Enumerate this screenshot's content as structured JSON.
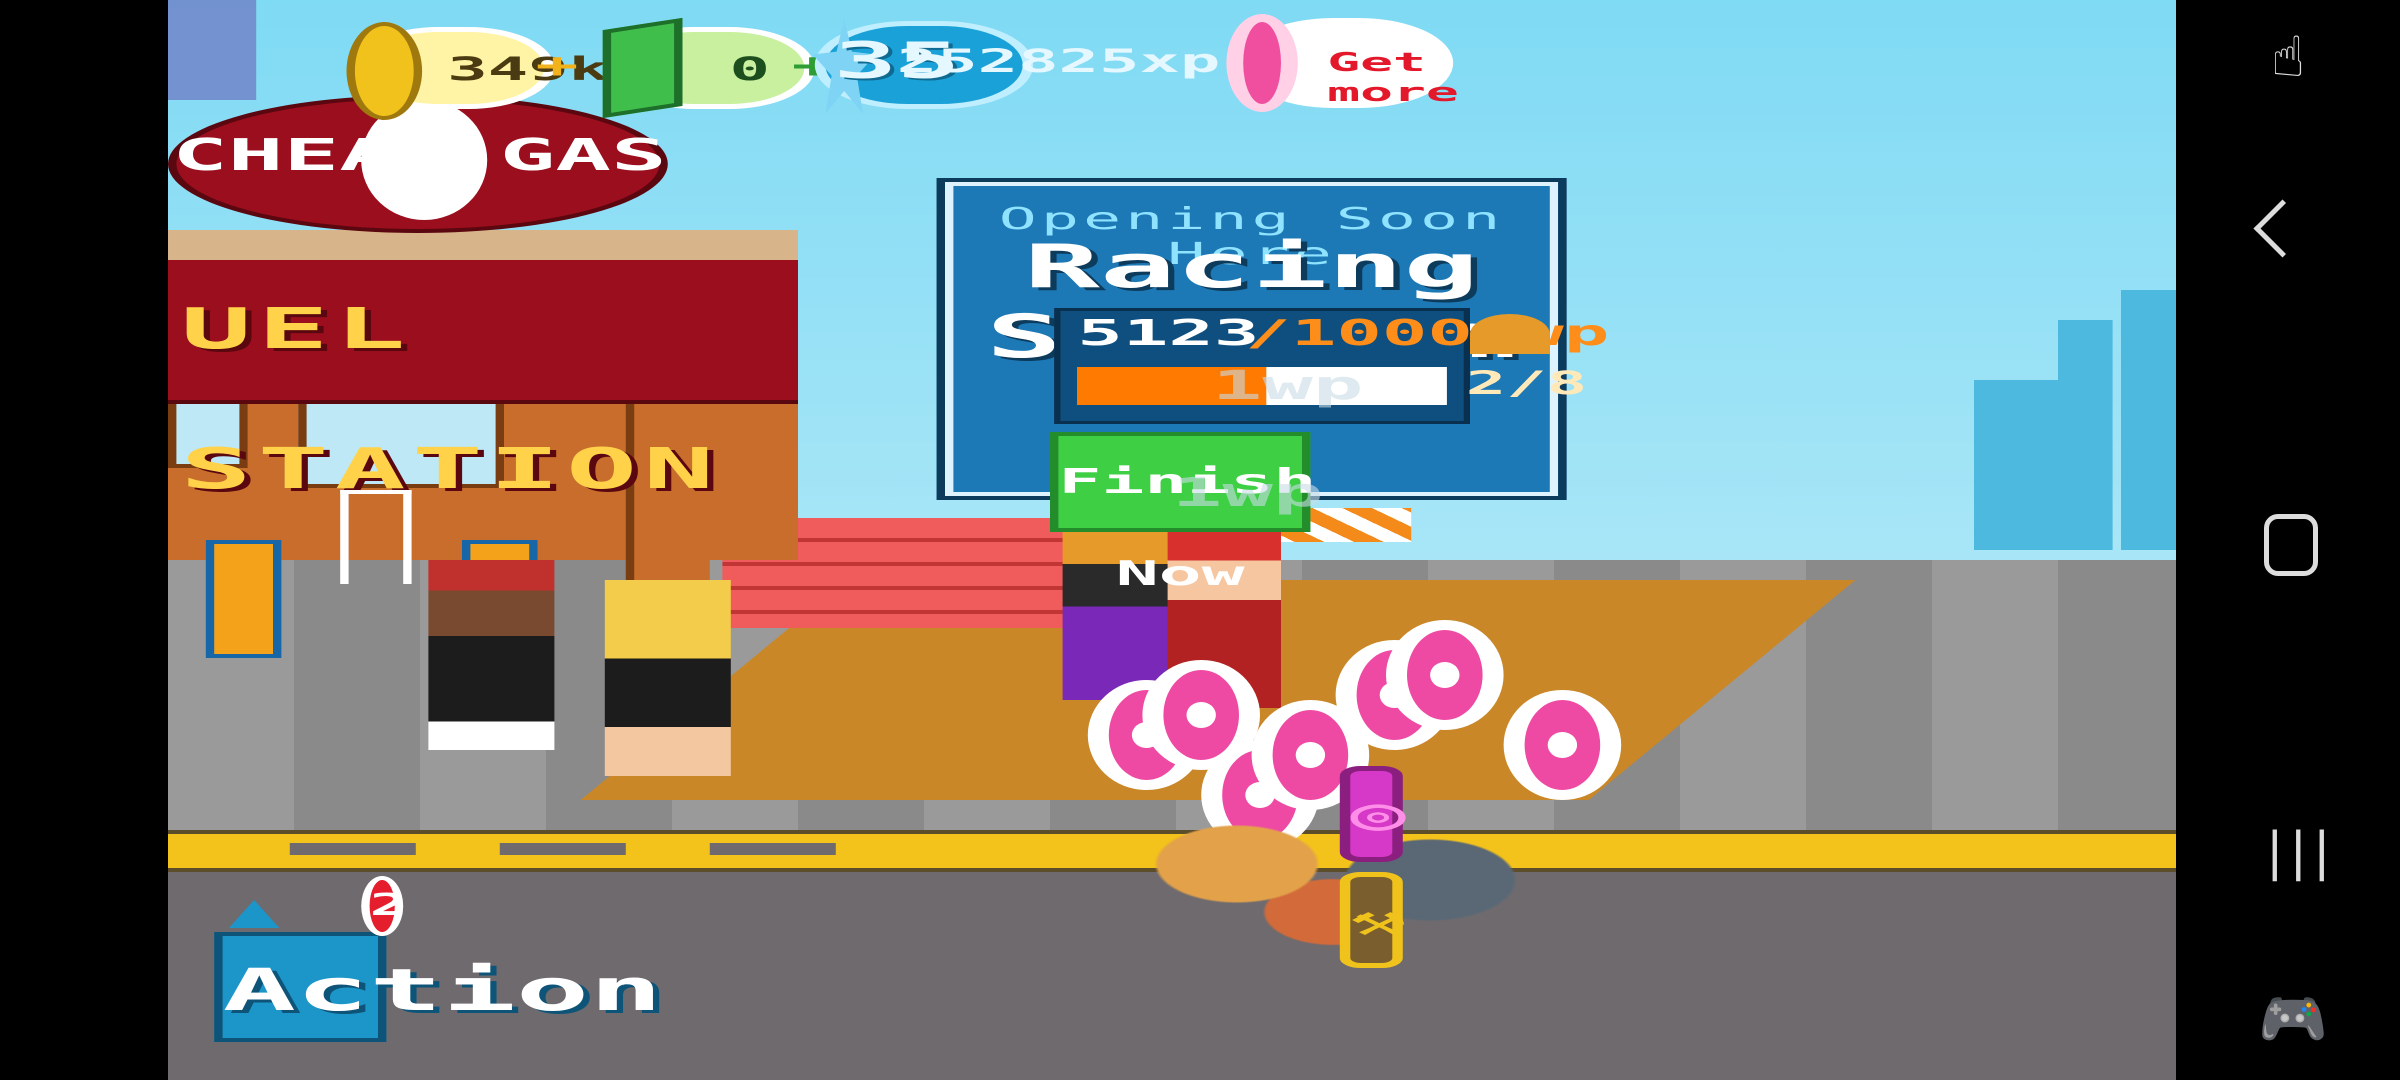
{
  "hud": {
    "coins": "349k",
    "cash": "0",
    "plus_symbol": "+",
    "level": "35",
    "xp": "252825xp",
    "get_more": "Get more"
  },
  "station": {
    "sign_left": "CHEAP",
    "sign_right": "GAS",
    "banner": "UEL STATION"
  },
  "construction": {
    "subtitle": "Opening Soon Here",
    "title": "Racing Stadium",
    "progress": "5123",
    "goal": "/10000wp",
    "progress_fraction": 0.5123,
    "helmet_count": "2/8",
    "finish_label": "Finish Now",
    "float_label_1": "1wp",
    "float_label_2": "1wp"
  },
  "action": {
    "label": "Action",
    "badge": "2"
  },
  "colors": {
    "sky": "#7fdaf4",
    "station_red": "#9b0e1e",
    "sign_yellow": "#ffd24a",
    "board_blue": "#1d78b6",
    "progress_orange": "#ff7a00",
    "finish_green": "#3fcf45",
    "donut_pink": "#ee4aa4"
  },
  "icons": {
    "coin": "coin-icon",
    "cash": "cash-icon",
    "xp": "star-icon",
    "donut": "donut-icon",
    "wrench": "wrench-icon",
    "nav_back": "back-icon",
    "nav_home": "home-icon",
    "nav_recents": "recents-icon",
    "nav_game": "gamepad-icon",
    "nav_touch": "touch-icon"
  }
}
